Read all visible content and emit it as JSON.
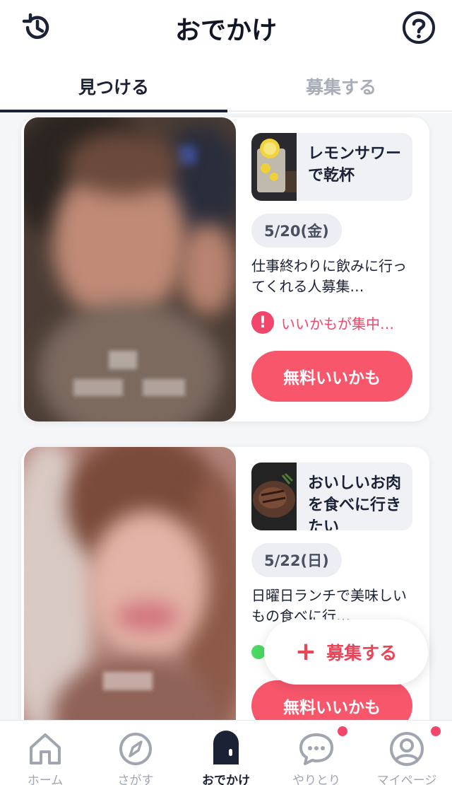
{
  "header": {
    "title": "おでかけ",
    "history_icon": "history-icon",
    "help_icon": "help-icon"
  },
  "tabs": [
    {
      "label": "見つける",
      "active": true
    },
    {
      "label": "募集する",
      "active": false
    }
  ],
  "cards": [
    {
      "topic_title": "レモンサワーで乾杯",
      "date": "5/20(金)",
      "description": "仕事終わりに飲みに行ってくれる人募集…",
      "alert_text": "いいかもが集中…",
      "like_button": "無料いいかも"
    },
    {
      "topic_title": "おいしいお肉を食べに行きたい",
      "date": "5/22(日)",
      "description": "日曜日ランチで美味しいもの食べに行…",
      "like_button": "無料いいかも"
    }
  ],
  "fab": {
    "label": "募集する"
  },
  "bottom_nav": [
    {
      "label": "ホーム",
      "icon": "home-icon",
      "active": false,
      "badge": false
    },
    {
      "label": "さがす",
      "icon": "compass-icon",
      "active": false,
      "badge": false
    },
    {
      "label": "おでかけ",
      "icon": "door-icon",
      "active": true,
      "badge": false
    },
    {
      "label": "やりとり",
      "icon": "chat-icon",
      "active": false,
      "badge": true
    },
    {
      "label": "マイページ",
      "icon": "profile-icon",
      "active": false,
      "badge": true
    }
  ],
  "colors": {
    "accent": "#f7566b",
    "alert": "#f2466a",
    "navy": "#1c2236",
    "muted": "#a0a5b1"
  }
}
